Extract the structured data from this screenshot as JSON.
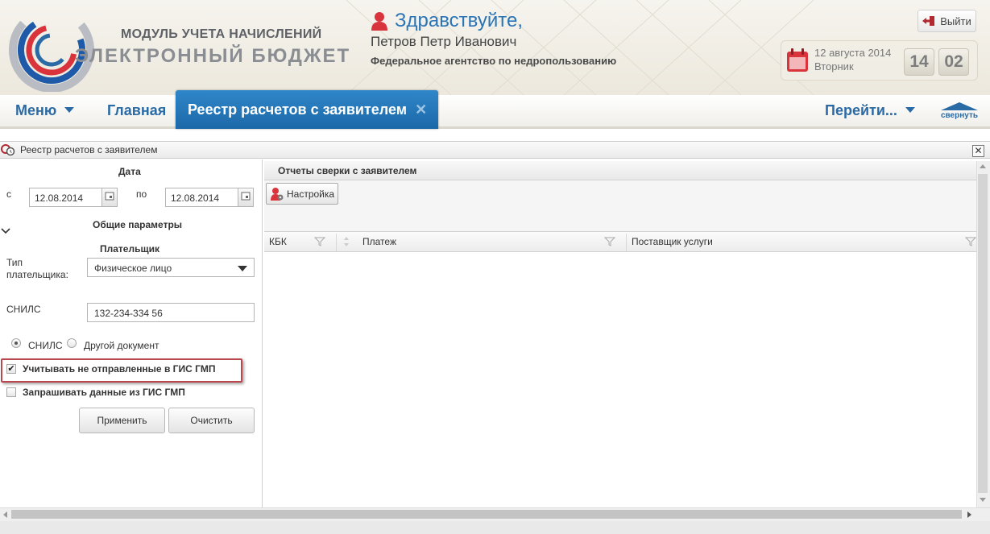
{
  "header": {
    "logo_line1": "МОДУЛЬ УЧЕТА НАЧИСЛЕНИЙ",
    "logo_line2": "ЭЛЕКТРОННЫЙ БЮДЖЕТ",
    "greeting": "Здравствуйте,",
    "user_name": "Петров Петр Иванович",
    "agency": "Федеральное агентство по недропользованию",
    "logout_label": "Выйти",
    "date": "12 августа 2014",
    "weekday": "Вторник",
    "hours": "14",
    "minutes": "02"
  },
  "nav": {
    "menu_label": "Меню",
    "home_label": "Главная",
    "active_tab_label": "Реестр расчетов с заявителем",
    "goto_label": "Перейти...",
    "collapse_label": "свернуть"
  },
  "panel": {
    "title": "Реестр расчетов с заявителем"
  },
  "filters": {
    "date_section": "Дата",
    "from_label": "с",
    "from_value": "12.08.2014",
    "to_label": "по",
    "to_value": "12.08.2014",
    "general_section": "Общие параметры",
    "payer_section": "Плательщик",
    "payer_type_label_line1": "Тип",
    "payer_type_label_line2": "плательщика:",
    "payer_type_value": "Физическое лицо",
    "snils_label": "СНИЛС",
    "snils_value": "132-234-334 56",
    "radio_snils": "СНИЛС",
    "radio_other": "Другой документ",
    "radio_selected": "СНИЛС",
    "chk_unsent_label": "Учитывать не отправленные в ГИС ГМП",
    "chk_unsent_checked": true,
    "chk_request_label": "Запрашивать данные из ГИС ГМП",
    "chk_request_checked": false,
    "apply_label": "Применить",
    "clear_label": "Очистить"
  },
  "grid": {
    "title": "Отчеты сверки с заявителем",
    "settings_label": "Настройка",
    "columns": [
      "КБК",
      "Платеж",
      "Поставщик услуги"
    ],
    "rows": []
  },
  "colors": {
    "brand_blue": "#2a6aa5",
    "active_tab": "#1c68a8",
    "highlight_red": "#b8474e",
    "calendar_red": "#d9343b"
  }
}
